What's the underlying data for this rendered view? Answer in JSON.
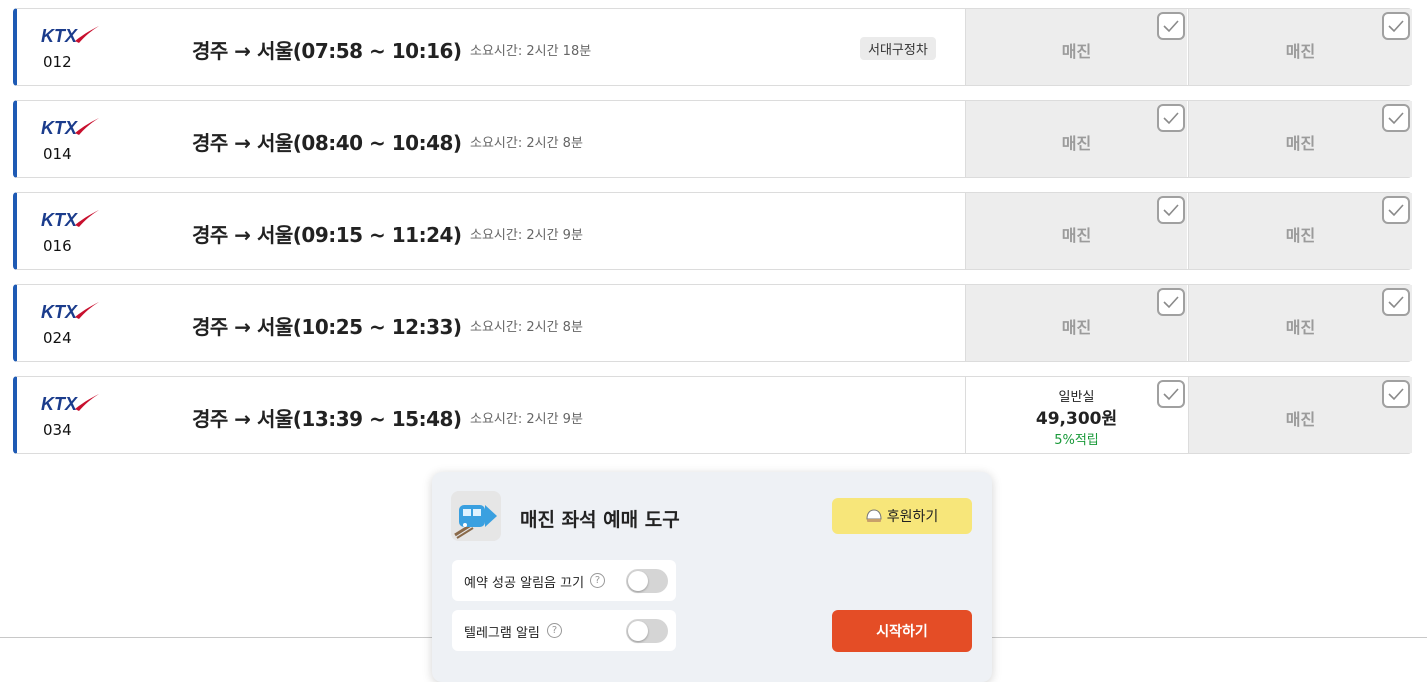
{
  "trains": [
    {
      "brand": "KTX",
      "number": "012",
      "route": "경주 → 서울(07:58 ~ 10:16)",
      "duration": "소요시간: 2시간 18분",
      "tag": "서대구정차",
      "general": {
        "status": "매진"
      },
      "special": {
        "status": "매진"
      }
    },
    {
      "brand": "KTX",
      "number": "014",
      "route": "경주 → 서울(08:40 ~ 10:48)",
      "duration": "소요시간: 2시간 8분",
      "tag": "",
      "general": {
        "status": "매진"
      },
      "special": {
        "status": "매진"
      }
    },
    {
      "brand": "KTX",
      "number": "016",
      "route": "경주 → 서울(09:15 ~ 11:24)",
      "duration": "소요시간: 2시간 9분",
      "tag": "",
      "general": {
        "status": "매진"
      },
      "special": {
        "status": "매진"
      }
    },
    {
      "brand": "KTX",
      "number": "024",
      "route": "경주 → 서울(10:25 ~ 12:33)",
      "duration": "소요시간: 2시간 8분",
      "tag": "",
      "general": {
        "status": "매진"
      },
      "special": {
        "status": "매진"
      }
    },
    {
      "brand": "KTX",
      "number": "034",
      "route": "경주 → 서울(13:39 ~ 15:48)",
      "duration": "소요시간: 2시간 9분",
      "tag": "",
      "general": {
        "status": "",
        "seat_type": "일반실",
        "price": "49,300원",
        "points": "5%적립"
      },
      "special": {
        "status": "매진"
      }
    }
  ],
  "panel": {
    "title": "매진 좌석 예매 도구",
    "donate_label": "후원하기",
    "options": [
      {
        "label": "예약 성공 알림음 끄기",
        "help": "?",
        "enabled": false
      },
      {
        "label": "텔레그램 알림",
        "help": "?",
        "enabled": false
      }
    ],
    "start_label": "시작하기"
  },
  "colors": {
    "accent_border": "#1e5ab4",
    "ktx_brand": "#1b3c8c",
    "donate": "#f7e67a",
    "start": "#e44d26",
    "points": "#1a9a3a"
  }
}
